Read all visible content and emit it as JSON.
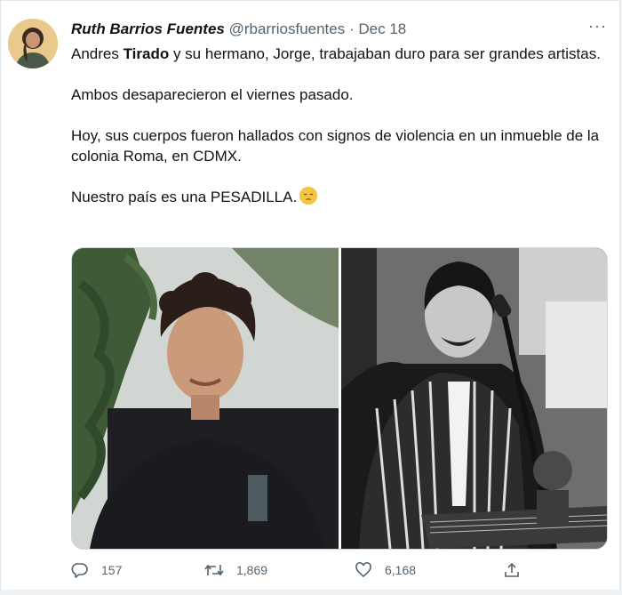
{
  "tweet": {
    "author_name": "Ruth Barrios Fuentes",
    "handle": "@rbarriosfuentes",
    "separator": "·",
    "date": "Dec 18",
    "more_glyph": "···",
    "text": {
      "line1_pre": "Andres ",
      "line1_bold": "Tirado",
      "line1_post": " y su hermano, Jorge, trabajaban duro para ser grandes artistas.",
      "para2": "Ambos desaparecieron el viernes pasado.",
      "para3": "Hoy, sus cuerpos fueron hallados con signos de violencia en un inmueble de la colonia Roma, en CDMX.",
      "para4": "Nuestro país es una PESADILLA."
    },
    "emoji_name": "pensive-face",
    "media": [
      {
        "name": "photo-young-man-curly-hair",
        "style": "color"
      },
      {
        "name": "photo-man-guitar-microphone",
        "style": "black-and-white"
      }
    ],
    "actions": {
      "reply_count": "157",
      "retweet_count": "1,869",
      "like_count": "6,168"
    }
  },
  "colors": {
    "text_primary": "#0f1419",
    "text_secondary": "#536471",
    "border": "#e1e8ed",
    "background": "#eef1f4"
  }
}
